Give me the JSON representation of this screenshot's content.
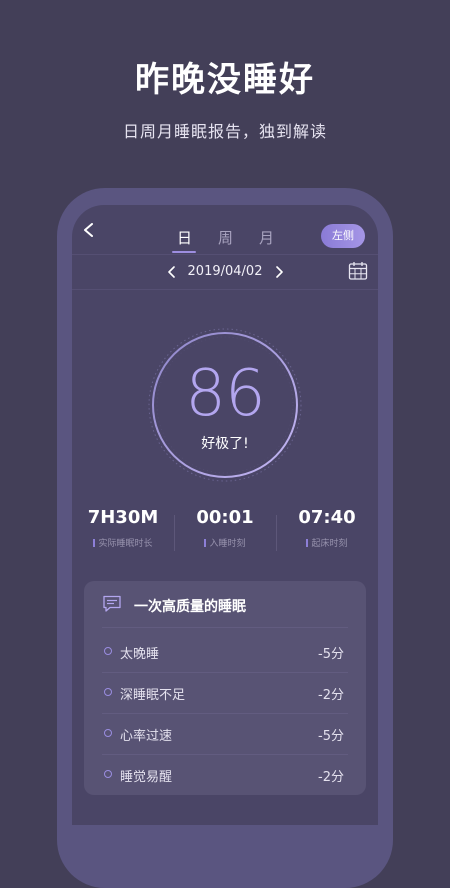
{
  "hero": {
    "title": "昨晚没睡好",
    "subtitle": "日周月睡眠报告，独到解读"
  },
  "header": {
    "tabs": [
      "日",
      "周",
      "月"
    ],
    "active_tab": "日",
    "side_button": "左侧"
  },
  "date_nav": {
    "date": "2019/04/02"
  },
  "score": {
    "value": "86",
    "label": "好极了!"
  },
  "stats": [
    {
      "value": "7H30M",
      "label": "实际睡眠时长"
    },
    {
      "value": "00:01",
      "label": "入睡时刻"
    },
    {
      "value": "07:40",
      "label": "起床时刻"
    }
  ],
  "quality_card": {
    "title": "一次高质量的睡眠",
    "items": [
      {
        "label": "太晚睡",
        "score": "-5分"
      },
      {
        "label": "深睡眠不足",
        "score": "-2分"
      },
      {
        "label": "心率过速",
        "score": "-5分"
      },
      {
        "label": "睡觉易醒",
        "score": "-2分"
      }
    ]
  },
  "colors": {
    "background": "#433f58",
    "screen": "#4a4566",
    "accent": "#9d8ee0",
    "score_ring": "#a898ea"
  },
  "icons": [
    "back-icon",
    "chevron-left-icon",
    "chevron-right-icon",
    "calendar-icon",
    "message-icon"
  ]
}
